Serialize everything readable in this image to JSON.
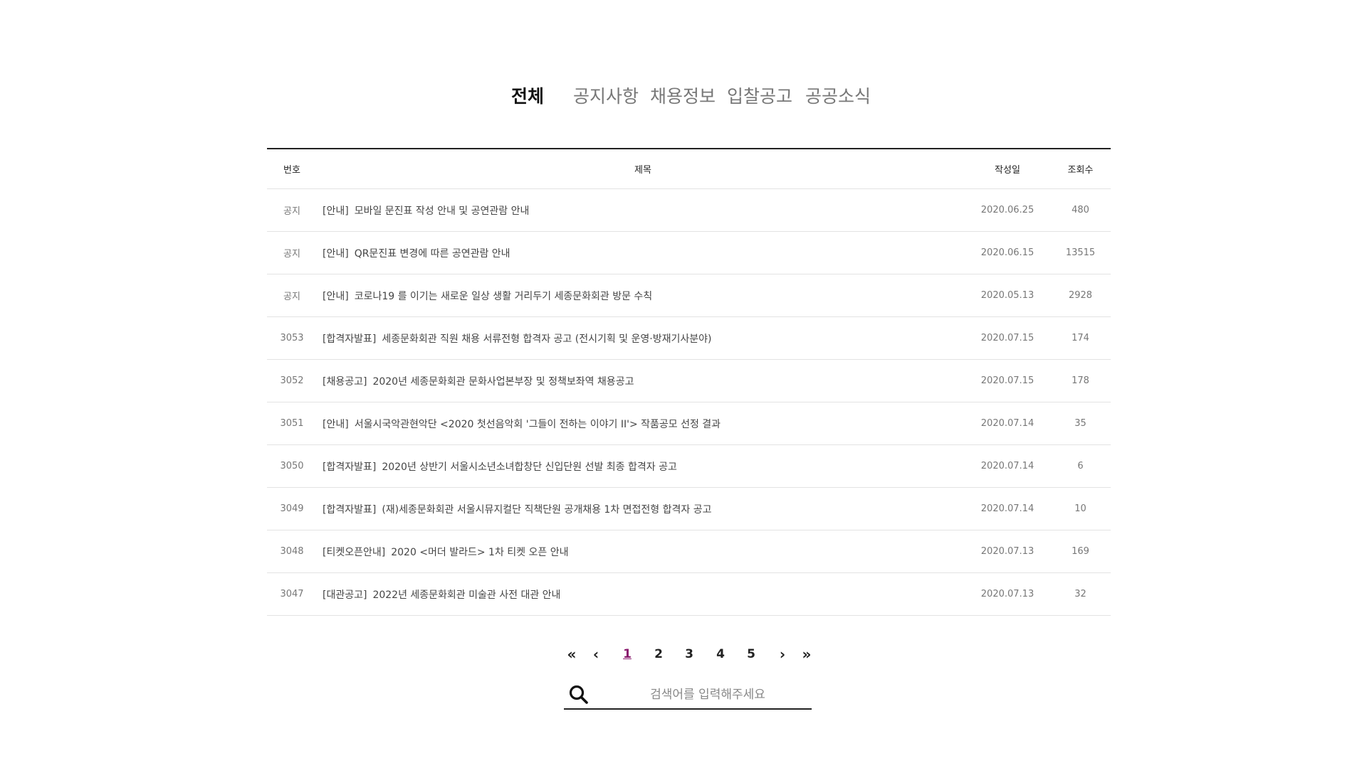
{
  "tabs": [
    {
      "label": "전체",
      "active": true
    },
    {
      "label": "공지사항",
      "active": false
    },
    {
      "label": "채용정보",
      "active": false
    },
    {
      "label": "입찰공고",
      "active": false
    },
    {
      "label": "공공소식",
      "active": false
    }
  ],
  "table": {
    "headers": {
      "num": "번호",
      "title": "제목",
      "date": "작성일",
      "views": "조회수"
    },
    "rows": [
      {
        "num": "공지",
        "category": "[안내]",
        "title": "모바일 문진표 작성 안내 및 공연관람 안내",
        "date": "2020.06.25",
        "views": "480"
      },
      {
        "num": "공지",
        "category": "[안내]",
        "title": "QR문진표 변경에 따른 공연관람 안내",
        "date": "2020.06.15",
        "views": "13515"
      },
      {
        "num": "공지",
        "category": "[안내]",
        "title": "코로나19 를 이기는 새로운 일상 생활 거리두기 세종문화회관 방문 수칙",
        "date": "2020.05.13",
        "views": "2928"
      },
      {
        "num": "3053",
        "category": "[합격자발표]",
        "title": "세종문화회관 직원 채용 서류전형 합격자 공고 (전시기획 및 운영·방재기사분야)",
        "date": "2020.07.15",
        "views": "174"
      },
      {
        "num": "3052",
        "category": "[채용공고]",
        "title": "2020년 세종문화회관 문화사업본부장 및 정책보좌역 채용공고",
        "date": "2020.07.15",
        "views": "178"
      },
      {
        "num": "3051",
        "category": "[안내]",
        "title": "서울시국악관현악단 <2020 첫선음악회 '그들이 전하는 이야기 II'> 작품공모 선정 결과",
        "date": "2020.07.14",
        "views": "35"
      },
      {
        "num": "3050",
        "category": "[합격자발표]",
        "title": "2020년 상반기 서울시소년소녀합창단 신입단원 선발 최종 합격자 공고",
        "date": "2020.07.14",
        "views": "6"
      },
      {
        "num": "3049",
        "category": "[합격자발표]",
        "title": "(재)세종문화회관 서울시뮤지컬단 직책단원 공개채용 1차 면접전형 합격자 공고",
        "date": "2020.07.14",
        "views": "10"
      },
      {
        "num": "3048",
        "category": "[티켓오픈안내]",
        "title": "2020 <머더 발라드> 1차 티켓 오픈 안내",
        "date": "2020.07.13",
        "views": "169"
      },
      {
        "num": "3047",
        "category": "[대관공고]",
        "title": "2022년 세종문화회관 미술관 사전 대관 안내",
        "date": "2020.07.13",
        "views": "32"
      }
    ]
  },
  "pagination": {
    "first": "«",
    "prev": "‹",
    "pages": [
      "1",
      "2",
      "3",
      "4",
      "5"
    ],
    "current": "1",
    "next": "›",
    "last": "»"
  },
  "search": {
    "placeholder": "검색어를 입력해주세요",
    "value": "",
    "icon": "search-icon"
  }
}
